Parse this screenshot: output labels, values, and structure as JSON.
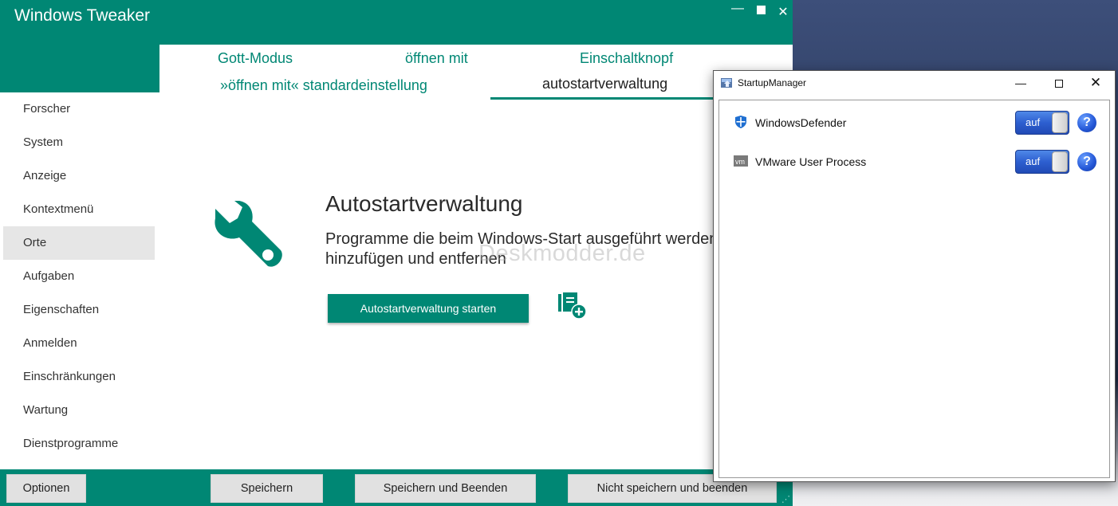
{
  "app": {
    "title": "Windows Tweaker",
    "accent": "#008774"
  },
  "tabs": [
    {
      "label": "Gott-Modus"
    },
    {
      "label": "öffnen mit"
    },
    {
      "label": "Einschaltknopf"
    },
    {
      "label": "»öffnen mit« standardeinstellung"
    },
    {
      "label": "autostartverwaltung",
      "active": true
    }
  ],
  "sidebar": {
    "items": [
      {
        "label": "Forscher"
      },
      {
        "label": "System"
      },
      {
        "label": "Anzeige"
      },
      {
        "label": "Kontextmenü"
      },
      {
        "label": "Orte",
        "selected": true
      },
      {
        "label": "Aufgaben"
      },
      {
        "label": "Eigenschaften"
      },
      {
        "label": "Anmelden"
      },
      {
        "label": "Einschränkungen"
      },
      {
        "label": "Wartung"
      },
      {
        "label": "Dienstprogramme"
      }
    ]
  },
  "main": {
    "icon": "wrench-icon",
    "heading": "Autostartverwaltung",
    "description_line1": "Programme die beim Windows-Start ausgeführt werden",
    "description_line2": "hinzufügen und entfernen",
    "start_button": "Autostartverwaltung starten",
    "add_icon": "add-entry-icon",
    "watermark": "Deskmodder.de"
  },
  "footer": {
    "options": "Optionen",
    "save": "Speichern",
    "save_exit": "Speichern und Beenden",
    "nosave_exit": "Nicht speichern und beenden"
  },
  "startup_manager": {
    "title": "StartupManager",
    "entries": [
      {
        "name": "WindowsDefender",
        "icon": "shield-icon",
        "toggle": "auf"
      },
      {
        "name": "VMware User Process",
        "icon": "vm-icon",
        "toggle": "auf"
      }
    ],
    "help": "?",
    "toggle_color": "#2d5fd0"
  }
}
